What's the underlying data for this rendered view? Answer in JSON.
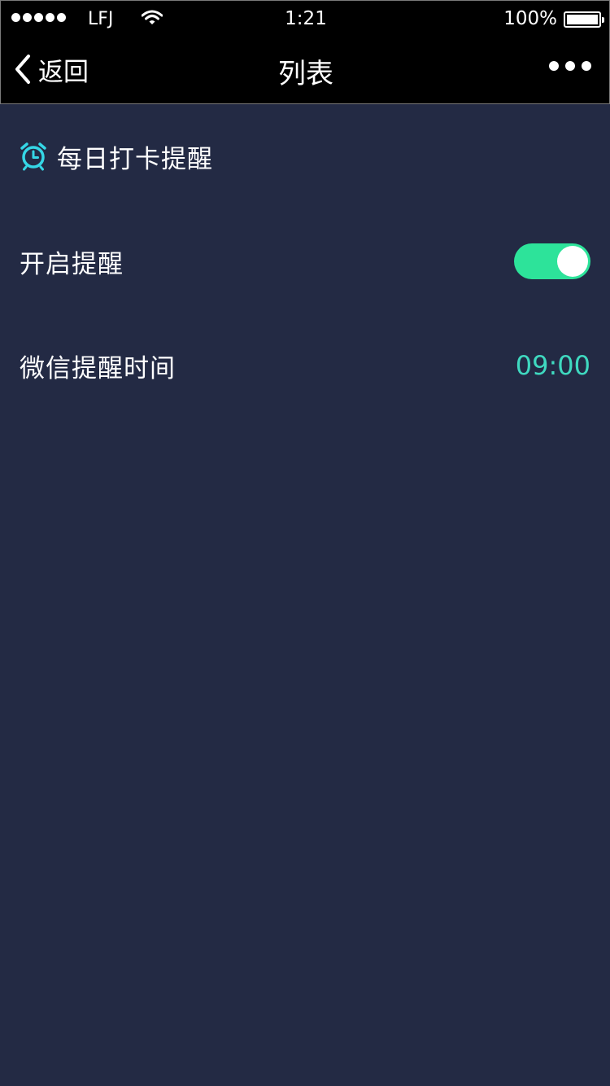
{
  "status_bar": {
    "carrier": "LFJ",
    "time": "1:21",
    "battery": "100%"
  },
  "nav": {
    "back_label": "返回",
    "title": "列表"
  },
  "section": {
    "title": "每日打卡提醒",
    "icon": "alarm-clock-icon",
    "icon_color": "#35d6e6"
  },
  "settings": {
    "reminder_label": "开启提醒",
    "reminder_enabled": true,
    "time_label": "微信提醒时间",
    "time_value": "09:00"
  },
  "colors": {
    "background": "#232a44",
    "toggle_on": "#2de39a",
    "accent_text": "#3fd9c0"
  }
}
